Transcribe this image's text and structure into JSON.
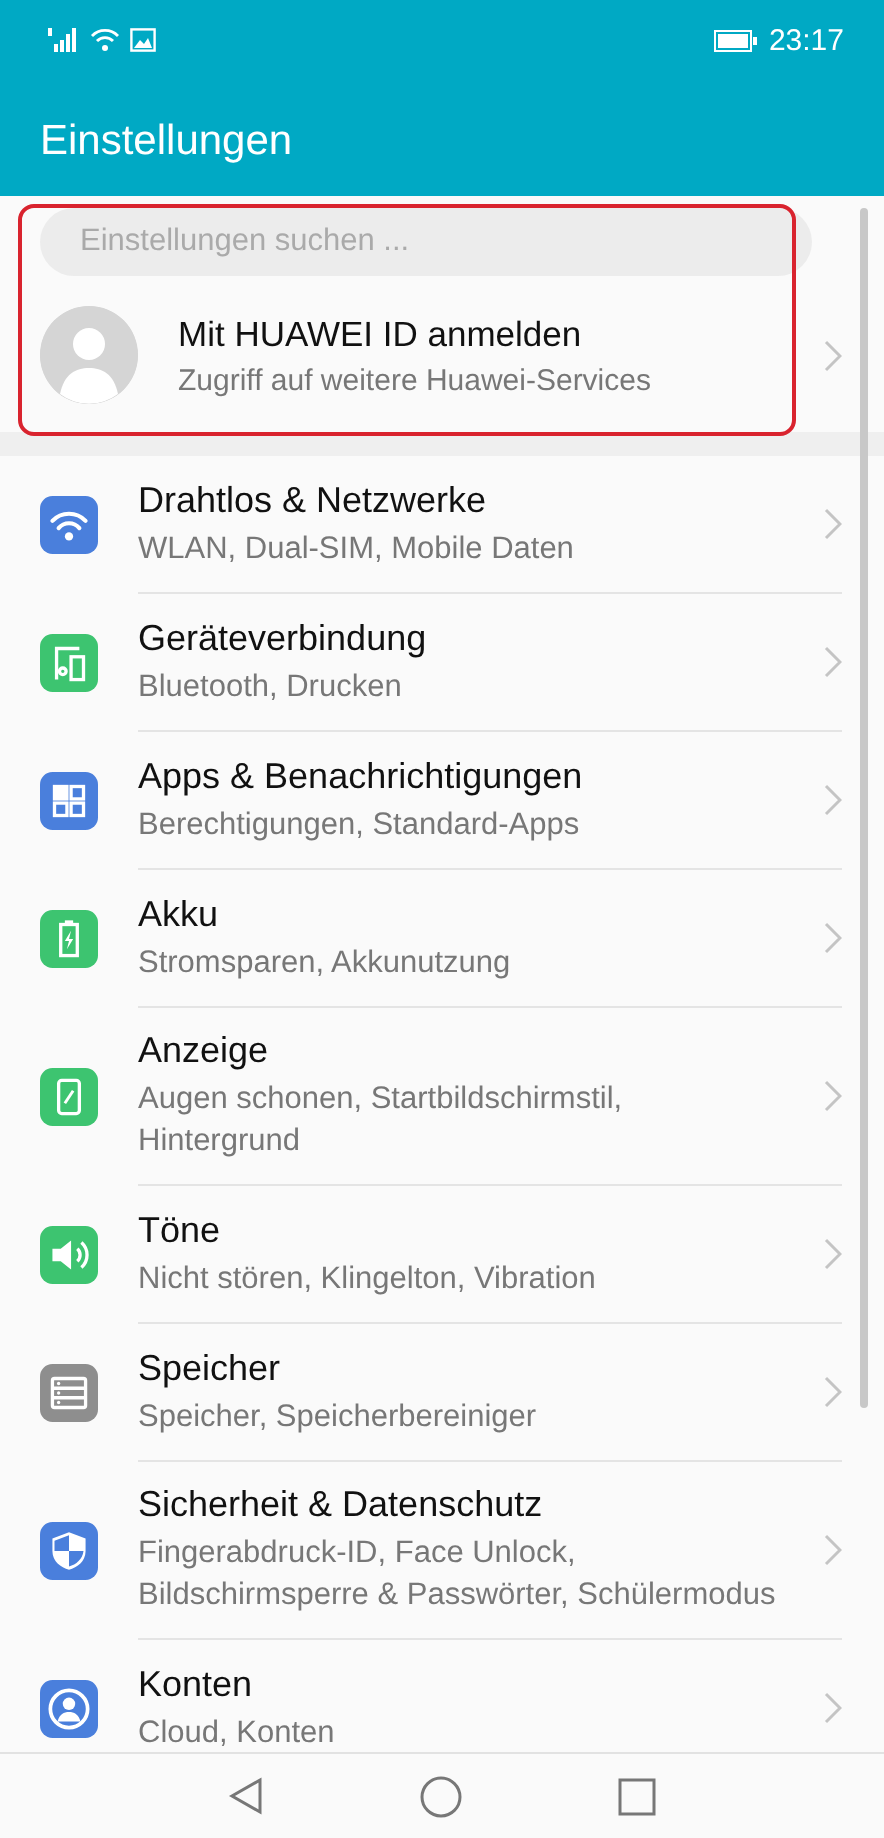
{
  "status_bar": {
    "time": "23:17"
  },
  "header": {
    "title": "Einstellungen"
  },
  "search": {
    "placeholder": "Einstellungen suchen ..."
  },
  "account": {
    "title": "Mit HUAWEI ID anmelden",
    "subtitle": "Zugriff auf weitere Huawei-Services",
    "highlighted": true
  },
  "settings": [
    {
      "kind": "wifi",
      "color": "#4a7fdc",
      "title": "Drahtlos & Netzwerke",
      "subtitle": "WLAN, Dual-SIM, Mobile Daten"
    },
    {
      "kind": "devices",
      "color": "#3dc470",
      "title": "Geräteverbindung",
      "subtitle": "Bluetooth, Drucken"
    },
    {
      "kind": "apps",
      "color": "#4a7fdc",
      "title": "Apps & Benachrichtigungen",
      "subtitle": "Berechtigungen, Standard-Apps"
    },
    {
      "kind": "battery",
      "color": "#3dc470",
      "title": "Akku",
      "subtitle": "Stromsparen, Akkunutzung"
    },
    {
      "kind": "display",
      "color": "#3dc470",
      "title": "Anzeige",
      "subtitle": [
        "Augen schonen, Startbildschirmstil,",
        "Hintergrund"
      ]
    },
    {
      "kind": "sound",
      "color": "#3dc470",
      "title": "Töne",
      "subtitle": "Nicht stören, Klingelton, Vibration"
    },
    {
      "kind": "storage",
      "color": "#8e8e8e",
      "title": "Speicher",
      "subtitle": "Speicher, Speicherbereiniger"
    },
    {
      "kind": "shield",
      "color": "#4a7fdc",
      "title": "Sicherheit & Datenschutz",
      "subtitle": [
        "Fingerabdruck-ID, Face Unlock,",
        "Bildschirmsperre & Passwörter, Schülermodus"
      ]
    },
    {
      "kind": "account",
      "color": "#4a7fdc",
      "title": "Konten",
      "subtitle": "Cloud, Konten"
    }
  ]
}
